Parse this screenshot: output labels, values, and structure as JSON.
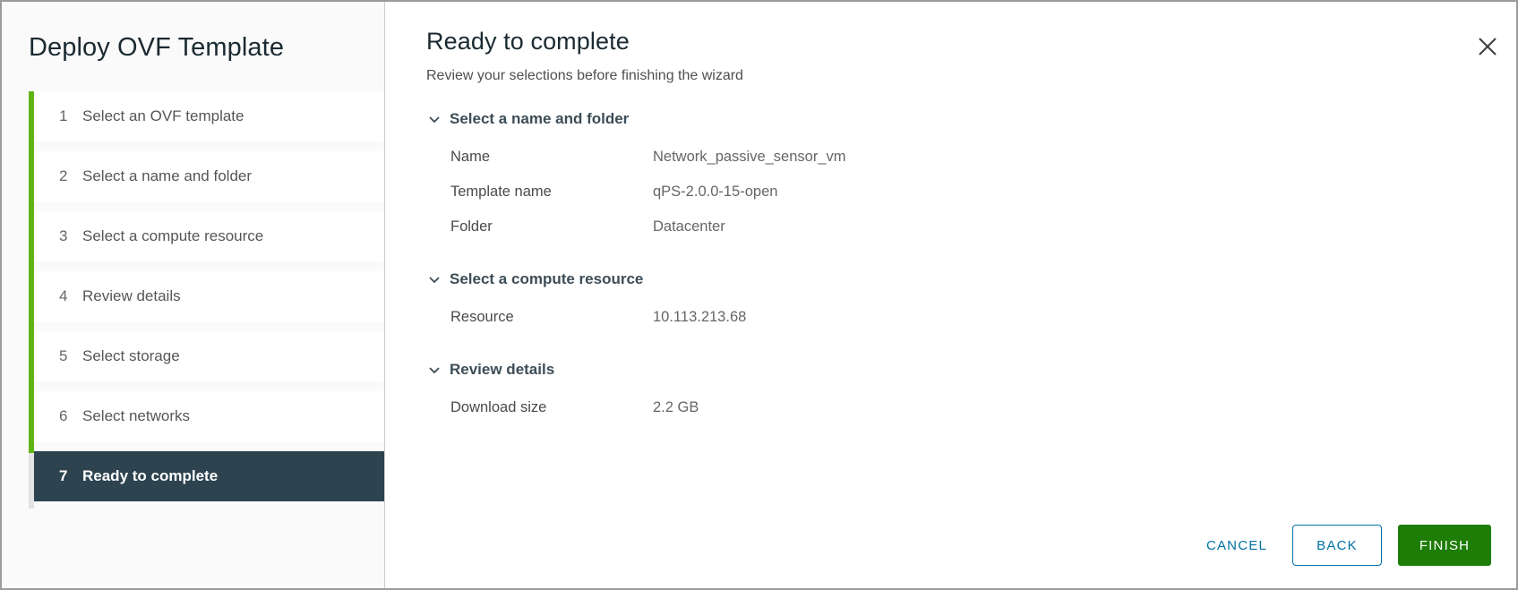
{
  "window": {
    "close_icon": "close-icon"
  },
  "sidebar": {
    "title": "Deploy OVF Template",
    "steps": [
      {
        "num": "1",
        "label": "Select an OVF template",
        "active": false
      },
      {
        "num": "2",
        "label": "Select a name and folder",
        "active": false
      },
      {
        "num": "3",
        "label": "Select a compute resource",
        "active": false
      },
      {
        "num": "4",
        "label": "Review details",
        "active": false
      },
      {
        "num": "5",
        "label": "Select storage",
        "active": false
      },
      {
        "num": "6",
        "label": "Select networks",
        "active": false
      },
      {
        "num": "7",
        "label": "Ready to complete",
        "active": true
      }
    ]
  },
  "main": {
    "title": "Ready to complete",
    "subtitle": "Review your selections before finishing the wizard",
    "sections": [
      {
        "header": "Select a name and folder",
        "expanded": true,
        "rows": [
          {
            "key": "Name",
            "value": "Network_passive_sensor_vm"
          },
          {
            "key": "Template name",
            "value": "qPS-2.0.0-15-open"
          },
          {
            "key": "Folder",
            "value": "Datacenter"
          }
        ]
      },
      {
        "header": "Select a compute resource",
        "expanded": true,
        "rows": [
          {
            "key": "Resource",
            "value": "10.113.213.68"
          }
        ]
      },
      {
        "header": "Review details",
        "expanded": true,
        "rows": [
          {
            "key": "Download size",
            "value": "2.2 GB"
          }
        ]
      }
    ]
  },
  "footer": {
    "cancel_label": "CANCEL",
    "back_label": "BACK",
    "finish_label": "FINISH"
  },
  "colors": {
    "progress_green": "#60b515",
    "active_step_bg": "#2d4450",
    "link_blue": "#0072a3",
    "finish_green": "#1d7d06"
  }
}
